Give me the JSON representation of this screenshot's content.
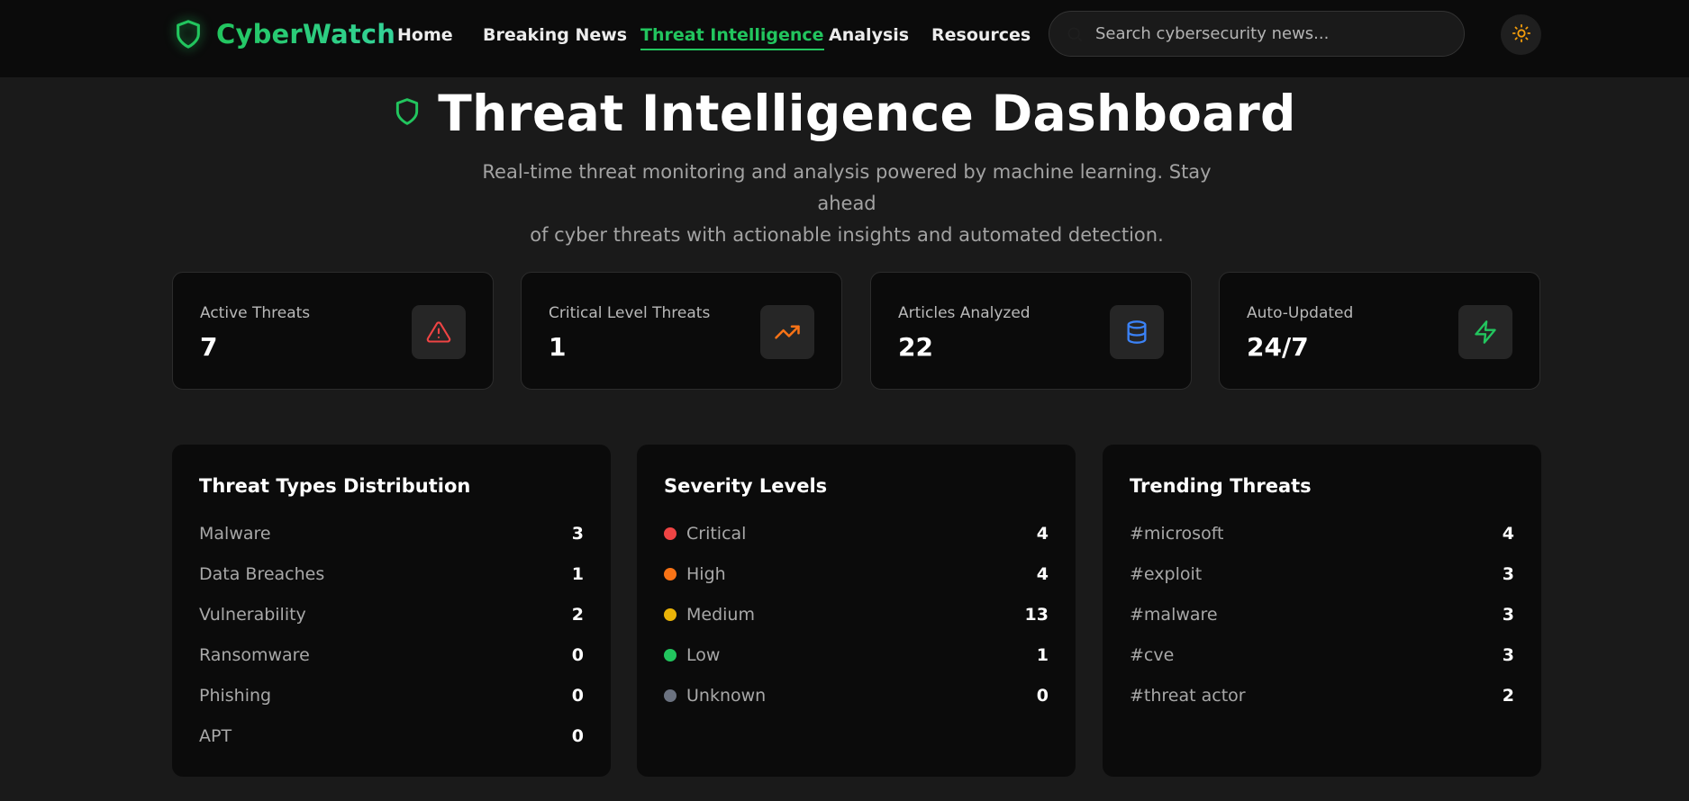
{
  "brand": {
    "name": "CyberWatch",
    "accent": "#22c55e"
  },
  "nav": {
    "items": [
      {
        "label": "Home"
      },
      {
        "label": "Breaking News"
      },
      {
        "label": "Threat Intelligence",
        "active": true
      },
      {
        "label": "Analysis"
      },
      {
        "label": "Resources"
      }
    ]
  },
  "search": {
    "placeholder": "Search cybersecurity news...",
    "value": ""
  },
  "theme_toggle": {
    "icon": "sun-icon",
    "color": "#f59e0b"
  },
  "hero": {
    "title": "Threat Intelligence Dashboard",
    "subtitle_line1": "Real-time threat monitoring and analysis powered by machine learning. Stay ahead",
    "subtitle_line2": "of cyber threats with actionable insights and automated detection."
  },
  "stats": [
    {
      "label": "Active Threats",
      "value": "7",
      "icon": "alert-triangle-icon",
      "color": "#ef4444"
    },
    {
      "label": "Critical Level Threats",
      "value": "1",
      "icon": "trending-up-icon",
      "color": "#f97316"
    },
    {
      "label": "Articles Analyzed",
      "value": "22",
      "icon": "database-icon",
      "color": "#3b82f6"
    },
    {
      "label": "Auto-Updated",
      "value": "24/7",
      "icon": "zap-icon",
      "color": "#22c55e"
    }
  ],
  "panels": {
    "threat_types": {
      "title": "Threat Types Distribution",
      "rows": [
        {
          "label": "Malware",
          "value": "3"
        },
        {
          "label": "Data Breaches",
          "value": "1"
        },
        {
          "label": "Vulnerability",
          "value": "2"
        },
        {
          "label": "Ransomware",
          "value": "0"
        },
        {
          "label": "Phishing",
          "value": "0"
        },
        {
          "label": "APT",
          "value": "0"
        }
      ]
    },
    "severity": {
      "title": "Severity Levels",
      "rows": [
        {
          "label": "Critical",
          "value": "4",
          "color": "#ef4444"
        },
        {
          "label": "High",
          "value": "4",
          "color": "#f97316"
        },
        {
          "label": "Medium",
          "value": "13",
          "color": "#eab308"
        },
        {
          "label": "Low",
          "value": "1",
          "color": "#22c55e"
        },
        {
          "label": "Unknown",
          "value": "0",
          "color": "#6b7280"
        }
      ]
    },
    "trending": {
      "title": "Trending Threats",
      "rows": [
        {
          "label": "#microsoft",
          "value": "4"
        },
        {
          "label": "#exploit",
          "value": "3"
        },
        {
          "label": "#malware",
          "value": "3"
        },
        {
          "label": "#cve",
          "value": "3"
        },
        {
          "label": "#threat actor",
          "value": "2"
        }
      ]
    }
  }
}
